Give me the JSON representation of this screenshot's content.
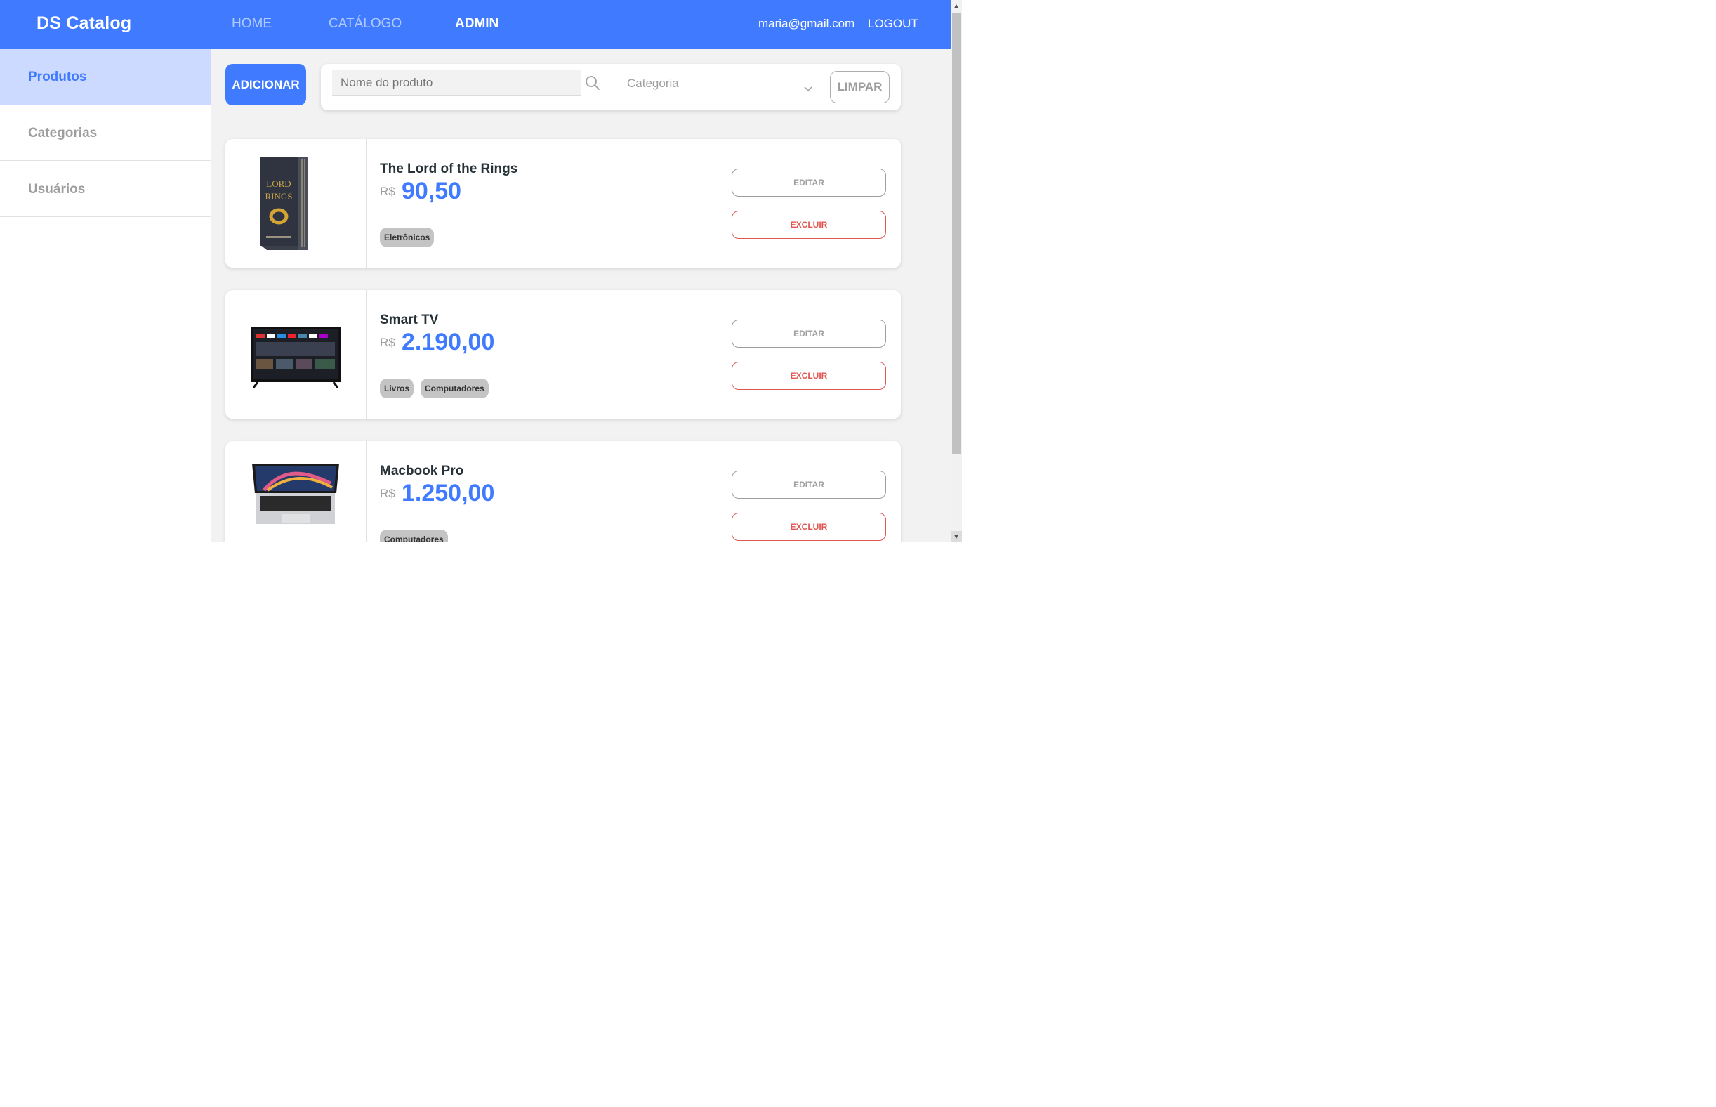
{
  "navbar": {
    "brand": "DS Catalog",
    "links": [
      {
        "label": "HOME",
        "active": false
      },
      {
        "label": "CATÁLOGO",
        "active": false
      },
      {
        "label": "ADMIN",
        "active": true
      }
    ],
    "user_email": "maria@gmail.com",
    "logout_label": "LOGOUT"
  },
  "sidebar": {
    "items": [
      {
        "label": "Produtos",
        "active": true
      },
      {
        "label": "Categorias",
        "active": false
      },
      {
        "label": "Usuários",
        "active": false
      }
    ]
  },
  "toolbar": {
    "add_label": "ADICIONAR",
    "search_placeholder": "Nome do produto",
    "category_placeholder": "Categoria",
    "clear_label": "LIMPAR"
  },
  "products": [
    {
      "name": "The Lord of the Rings",
      "currency": "R$",
      "price": "90,50",
      "categories": [
        "Eletrônicos"
      ],
      "edit_label": "EDITAR",
      "delete_label": "EXCLUIR"
    },
    {
      "name": "Smart TV",
      "currency": "R$",
      "price": "2.190,00",
      "categories": [
        "Livros",
        "Computadores"
      ],
      "edit_label": "EDITAR",
      "delete_label": "EXCLUIR"
    },
    {
      "name": "Macbook Pro",
      "currency": "R$",
      "price": "1.250,00",
      "categories": [
        "Computadores"
      ],
      "edit_label": "EDITAR",
      "delete_label": "EXCLUIR"
    }
  ],
  "colors": {
    "primary": "#407bff",
    "danger": "#df5753",
    "sidebar_active_bg": "#cddaff",
    "background": "#f2f2f2"
  }
}
